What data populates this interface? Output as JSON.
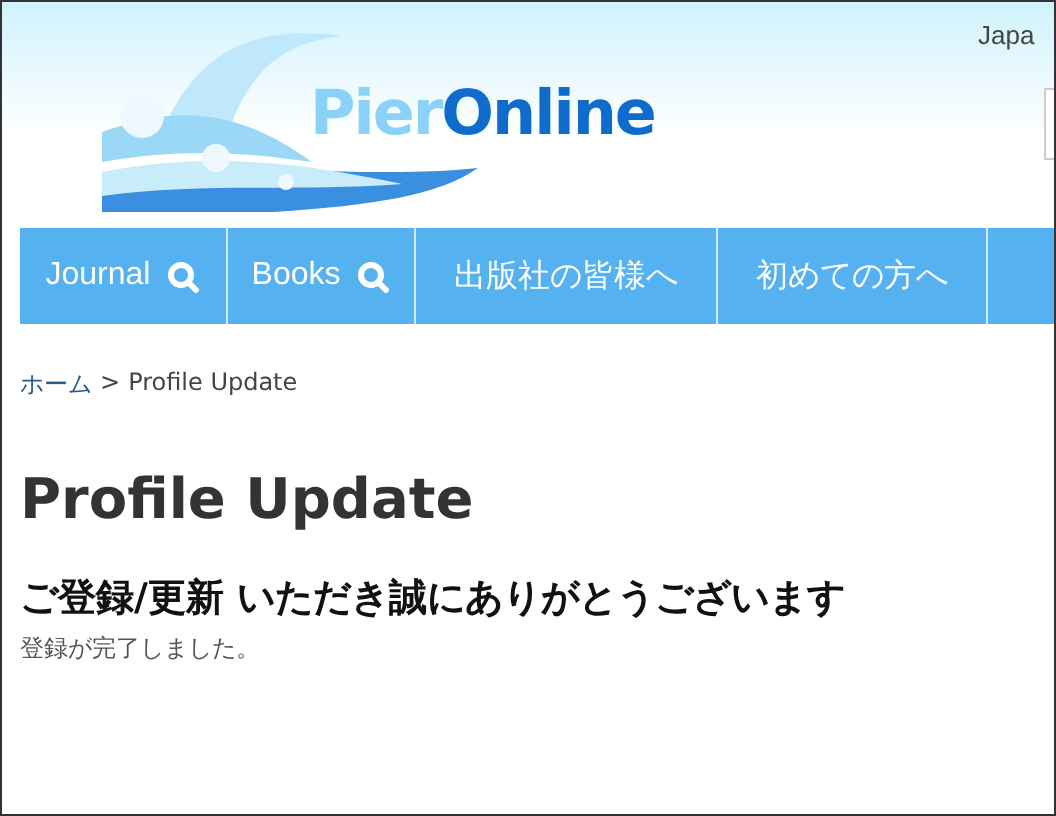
{
  "header": {
    "logo": {
      "part1": "Pier",
      "part2": "Online"
    },
    "language": "Japa"
  },
  "nav": [
    {
      "label": "Journal",
      "search": true
    },
    {
      "label": "Books",
      "search": true
    },
    {
      "label": "出版社の皆様へ",
      "search": false
    },
    {
      "label": "初めての方へ",
      "search": false
    }
  ],
  "breadcrumb": {
    "home": "ホーム",
    "separator": ">",
    "current": "Profile Update"
  },
  "title": "Profile Update",
  "heading": "ご登録/更新 いただき誠にありがとうございます",
  "message": "登録が完了しました。"
}
